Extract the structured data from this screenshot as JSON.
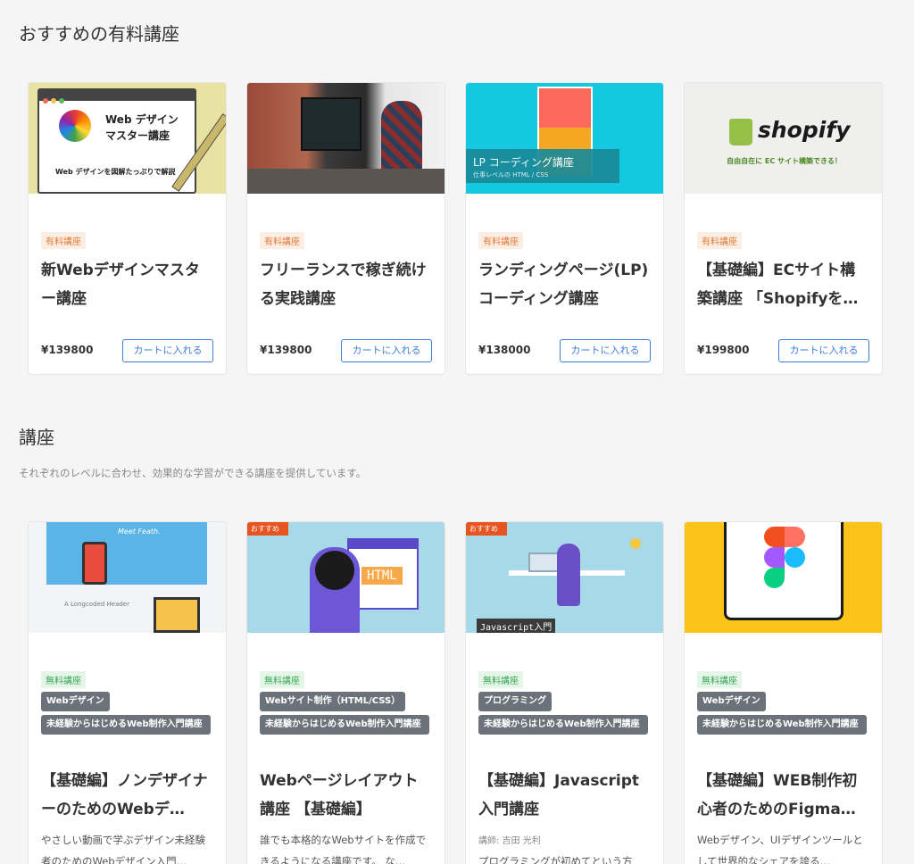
{
  "sections": {
    "recommended_title": "おすすめの有料講座",
    "courses_title": "講座",
    "courses_desc": "それぞれのレベルに合わせ、効果的な学習ができる講座を提供しています。"
  },
  "paid_courses": [
    {
      "tag": "有料講座",
      "title": "新Webデザインマスター講座",
      "price": "¥139800",
      "cart": "カートに入れる",
      "thumb": {
        "line1": "Web デザイン",
        "line2": "マスター講座",
        "caption": "Web デザインを図解たっぷりで解説"
      }
    },
    {
      "tag": "有料講座",
      "title": "フリーランスで稼ぎ続ける実践講座",
      "price": "¥139800",
      "cart": "カートに入れる"
    },
    {
      "tag": "有料講座",
      "title": "ランディングページ(LP)コーディング講座",
      "price": "¥138000",
      "cart": "カートに入れる",
      "thumb": {
        "line1": "LP コーディング講座",
        "line2": "仕事レベルの HTML / CSS"
      }
    },
    {
      "tag": "有料講座",
      "title": "【基礎編】ECサイト構築講座 「Shopifyを…",
      "price": "¥199800",
      "cart": "カートに入れる",
      "thumb": {
        "logo": "shopify",
        "caption": "自由自在に EC サイト構築できる！"
      }
    }
  ],
  "free_courses": [
    {
      "tag": "無料講座",
      "category": "Webデザイン",
      "series": "未経験からはじめるWeb制作入門講座",
      "title": "【基礎編】ノンデザイナーのためのWebデ…",
      "desc": "やさしい動画で学ぶデザイン未経験者のためのWebデザイン入門…",
      "thumb": {
        "brand": "Meet Feath.",
        "heading": "A Longcoded Header"
      }
    },
    {
      "tag": "無料講座",
      "category": "Webサイト制作（HTML/CSS）",
      "series": "未経験からはじめるWeb制作入門講座",
      "title": "Webページレイアウト講座 【基礎編】",
      "desc": "誰でも本格的なWebサイトを作成できるようになる講座です。 な…",
      "thumb": {
        "ribbon": "おすすめ",
        "label": "HTML"
      }
    },
    {
      "tag": "無料講座",
      "category": "プログラミング",
      "series": "未経験からはじめるWeb制作入門講座",
      "title": "【基礎編】Javascript入門講座",
      "instructor": "講師: 吉田 光利",
      "desc": "プログラミングが初めてという方",
      "thumb": {
        "ribbon": "おすすめ",
        "label": "Javascript入門"
      }
    },
    {
      "tag": "無料講座",
      "category": "Webデザイン",
      "series": "未経験からはじめるWeb制作入門講座",
      "title": "【基礎編】WEB制作初心者のためのFigma…",
      "desc": "Webデザイン、UIデザインツールとして世界的なシェアを誇る…"
    }
  ],
  "colors": {
    "accent": "#3d7edb",
    "paid_tag": "#e07b39",
    "free_tag": "#3aa757",
    "genre_tag": "#6c7279"
  }
}
